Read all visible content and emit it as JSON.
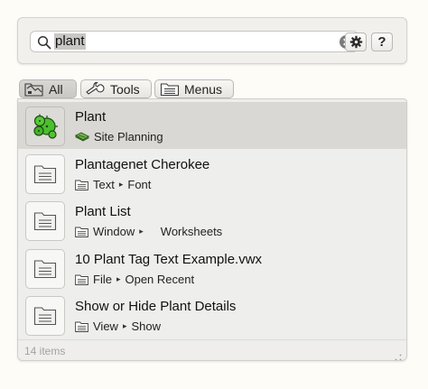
{
  "search": {
    "query": "plant"
  },
  "toolbar": {
    "help_label": "?"
  },
  "tabs": [
    {
      "label": "All",
      "icon": "all-folder-icon",
      "active": true
    },
    {
      "label": "Tools",
      "icon": "wrench-icon",
      "active": false
    },
    {
      "label": "Menus",
      "icon": "menu-folder-icon",
      "active": false
    }
  ],
  "results": [
    {
      "title": "Plant",
      "icon": "plant-tool-icon",
      "path": [
        "Site Planning"
      ],
      "path_icon": "site-planning-icon",
      "selected": true
    },
    {
      "title": "Plantagenet Cherokee",
      "icon": "menu-item-icon",
      "path": [
        "Text",
        "Font"
      ],
      "path_icon": "menu-folder-icon",
      "selected": false
    },
    {
      "title": "Plant List",
      "icon": "menu-item-icon",
      "path": [
        "Window",
        "Worksheets"
      ],
      "path_icon": "menu-folder-icon",
      "selected": false
    },
    {
      "title": "10 Plant Tag Text Example.vwx",
      "icon": "menu-item-icon",
      "path": [
        "File",
        "Open Recent"
      ],
      "path_icon": "menu-folder-icon",
      "selected": false
    },
    {
      "title": "Show or Hide Plant Details",
      "icon": "menu-item-icon",
      "path": [
        "View",
        "Show"
      ],
      "path_icon": "menu-folder-icon",
      "selected": false
    }
  ],
  "status": {
    "count_text": "14 items"
  },
  "colors": {
    "selection": "#d9d8d4",
    "panel": "#eeeeec",
    "plant_green": "#4bbf2e"
  }
}
